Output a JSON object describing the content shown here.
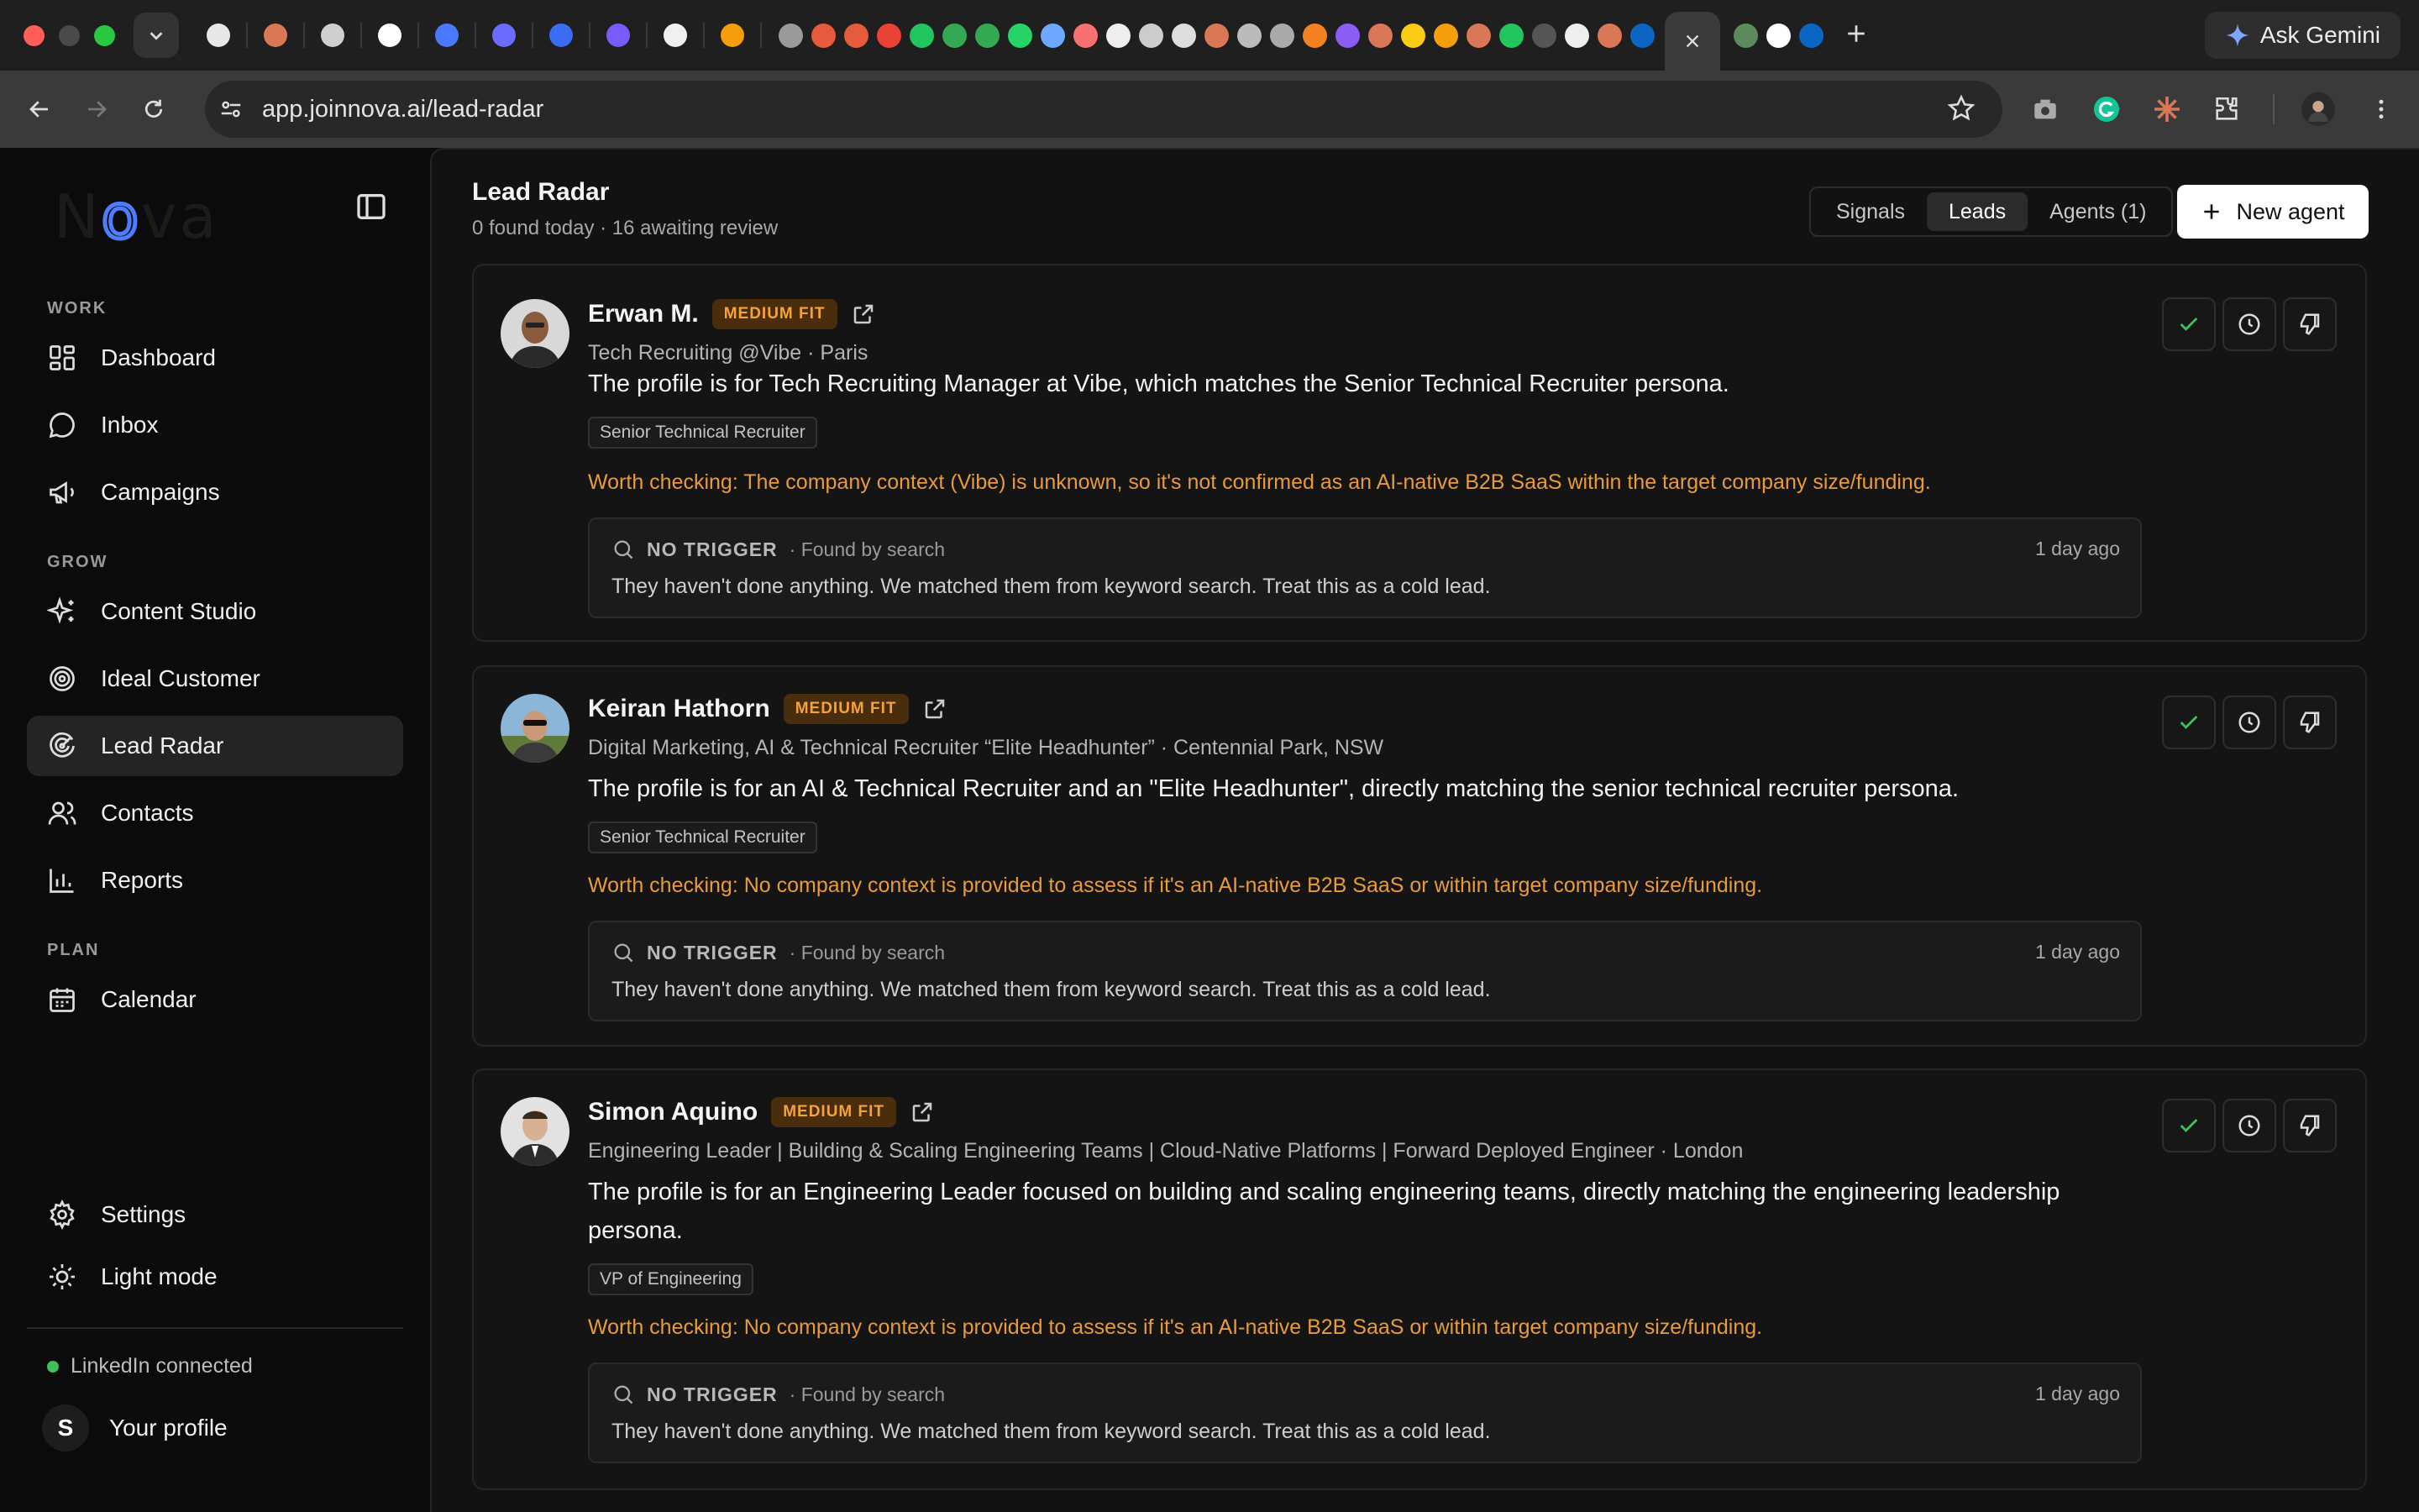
{
  "browser": {
    "url": "app.joinnova.ai/lead-radar",
    "gemini_label": "Ask Gemini"
  },
  "sidebar": {
    "logo": "Nova",
    "sections": {
      "work": "WORK",
      "grow": "GROW",
      "plan": "PLAN"
    },
    "items": {
      "dashboard": "Dashboard",
      "inbox": "Inbox",
      "campaigns": "Campaigns",
      "content_studio": "Content Studio",
      "ideal_customer": "Ideal Customer",
      "lead_radar": "Lead Radar",
      "contacts": "Contacts",
      "reports": "Reports",
      "calendar": "Calendar",
      "settings": "Settings",
      "light_mode": "Light mode"
    },
    "linkedin_status": "LinkedIn connected",
    "profile_initial": "S",
    "profile_label": "Your profile"
  },
  "header": {
    "title": "Lead Radar",
    "subtitle": "0 found today · 16 awaiting review",
    "tabs": [
      "Signals",
      "Leads",
      "Agents (1)"
    ],
    "active_tab": "Leads",
    "new_agent": "New agent"
  },
  "leads": [
    {
      "name": "Erwan M.",
      "fit": "MEDIUM FIT",
      "headline": "Tech Recruiting @Vibe · Paris",
      "summary": "The profile is for Tech Recruiting Manager at Vibe, which matches the Senior Technical Recruiter persona.",
      "persona": "Senior Technical Recruiter",
      "warning": "Worth checking: The company context (Vibe) is unknown, so it's not confirmed as an AI-native B2B SaaS within the target company size/funding.",
      "trigger": "NO TRIGGER",
      "source": "· Found by search",
      "time": "1 day ago",
      "trigger_text": "They haven't done anything. We matched them from keyword search. Treat this as a cold lead."
    },
    {
      "name": "Keiran Hathorn",
      "fit": "MEDIUM FIT",
      "headline": "Digital Marketing, AI & Technical Recruiter “Elite Headhunter” · Centennial Park, NSW",
      "summary": "The profile is for an AI & Technical Recruiter and an \"Elite Headhunter\", directly matching the senior technical recruiter persona.",
      "persona": "Senior Technical Recruiter",
      "warning": "Worth checking: No company context is provided to assess if it's an AI-native B2B SaaS or within target company size/funding.",
      "trigger": "NO TRIGGER",
      "source": "· Found by search",
      "time": "1 day ago",
      "trigger_text": "They haven't done anything. We matched them from keyword search. Treat this as a cold lead."
    },
    {
      "name": "Simon Aquino",
      "fit": "MEDIUM FIT",
      "headline": "Engineering Leader | Building & Scaling Engineering Teams | Cloud-Native Platforms | Forward Deployed Engineer · London",
      "summary": "The profile is for an Engineering Leader focused on building and scaling engineering teams, directly matching the engineering leadership persona.",
      "persona": "VP of Engineering",
      "warning": "Worth checking: No company context is provided to assess if it's an AI-native B2B SaaS or within target company size/funding.",
      "trigger": "NO TRIGGER",
      "source": "· Found by search",
      "time": "1 day ago",
      "trigger_text": "They haven't done anything. We matched them from keyword search. Treat this as a cold lead."
    }
  ],
  "colors": {
    "accent_warning": "#e99a3a",
    "fit_badge_bg": "#4a2d0d",
    "fit_badge_text": "#f6a23c",
    "approve_check": "#3fbf5c",
    "linkedin_dot": "#3fbf5c"
  }
}
